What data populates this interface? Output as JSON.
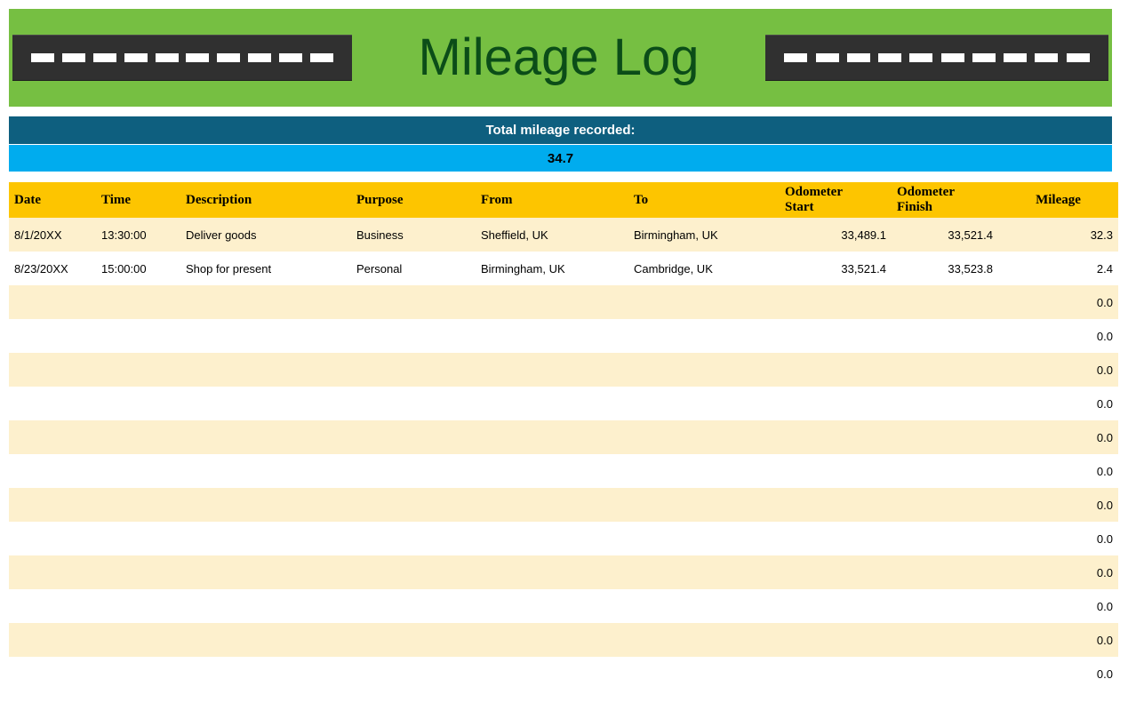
{
  "banner": {
    "title": "Mileage Log",
    "bg_color": "#76bf42",
    "title_color": "#0b4d18",
    "road_color": "#303030",
    "dash_count": 10
  },
  "summary": {
    "label": "Total mileage recorded:",
    "value": "34.7",
    "label_bg": "#0e5f7f",
    "value_bg": "#00acee"
  },
  "table": {
    "header_bg": "#fdc500",
    "band_bg": "#fdf0cd",
    "columns": [
      {
        "label": "Date",
        "key": "date"
      },
      {
        "label": "Time",
        "key": "time"
      },
      {
        "label": "Description",
        "key": "description"
      },
      {
        "label": "Purpose",
        "key": "purpose"
      },
      {
        "label": "From",
        "key": "from"
      },
      {
        "label": "To",
        "key": "to"
      },
      {
        "label": "Odometer Start",
        "label_line1": "Odometer",
        "label_line2": "Start",
        "key": "odometer_start"
      },
      {
        "label": "Odometer Finish",
        "label_line1": "Odometer",
        "label_line2": "Finish",
        "key": "odometer_finish"
      },
      {
        "label": "Mileage",
        "key": "mileage"
      }
    ],
    "rows": [
      {
        "date": "8/1/20XX",
        "time": "13:30:00",
        "description": "Deliver goods",
        "purpose": "Business",
        "from": "Sheffield, UK",
        "to": "Birmingham, UK",
        "odometer_start": "33,489.1",
        "odometer_finish": "33,521.4",
        "mileage": "32.3"
      },
      {
        "date": "8/23/20XX",
        "time": "15:00:00",
        "description": "Shop for present",
        "purpose": "Personal",
        "from": "Birmingham, UK",
        "to": "Cambridge, UK",
        "odometer_start": "33,521.4",
        "odometer_finish": "33,523.8",
        "mileage": "2.4"
      },
      {
        "date": "",
        "time": "",
        "description": "",
        "purpose": "",
        "from": "",
        "to": "",
        "odometer_start": "",
        "odometer_finish": "",
        "mileage": "0.0"
      },
      {
        "date": "",
        "time": "",
        "description": "",
        "purpose": "",
        "from": "",
        "to": "",
        "odometer_start": "",
        "odometer_finish": "",
        "mileage": "0.0"
      },
      {
        "date": "",
        "time": "",
        "description": "",
        "purpose": "",
        "from": "",
        "to": "",
        "odometer_start": "",
        "odometer_finish": "",
        "mileage": "0.0"
      },
      {
        "date": "",
        "time": "",
        "description": "",
        "purpose": "",
        "from": "",
        "to": "",
        "odometer_start": "",
        "odometer_finish": "",
        "mileage": "0.0"
      },
      {
        "date": "",
        "time": "",
        "description": "",
        "purpose": "",
        "from": "",
        "to": "",
        "odometer_start": "",
        "odometer_finish": "",
        "mileage": "0.0"
      },
      {
        "date": "",
        "time": "",
        "description": "",
        "purpose": "",
        "from": "",
        "to": "",
        "odometer_start": "",
        "odometer_finish": "",
        "mileage": "0.0"
      },
      {
        "date": "",
        "time": "",
        "description": "",
        "purpose": "",
        "from": "",
        "to": "",
        "odometer_start": "",
        "odometer_finish": "",
        "mileage": "0.0"
      },
      {
        "date": "",
        "time": "",
        "description": "",
        "purpose": "",
        "from": "",
        "to": "",
        "odometer_start": "",
        "odometer_finish": "",
        "mileage": "0.0"
      },
      {
        "date": "",
        "time": "",
        "description": "",
        "purpose": "",
        "from": "",
        "to": "",
        "odometer_start": "",
        "odometer_finish": "",
        "mileage": "0.0"
      },
      {
        "date": "",
        "time": "",
        "description": "",
        "purpose": "",
        "from": "",
        "to": "",
        "odometer_start": "",
        "odometer_finish": "",
        "mileage": "0.0"
      },
      {
        "date": "",
        "time": "",
        "description": "",
        "purpose": "",
        "from": "",
        "to": "",
        "odometer_start": "",
        "odometer_finish": "",
        "mileage": "0.0"
      },
      {
        "date": "",
        "time": "",
        "description": "",
        "purpose": "",
        "from": "",
        "to": "",
        "odometer_start": "",
        "odometer_finish": "",
        "mileage": "0.0"
      }
    ]
  }
}
